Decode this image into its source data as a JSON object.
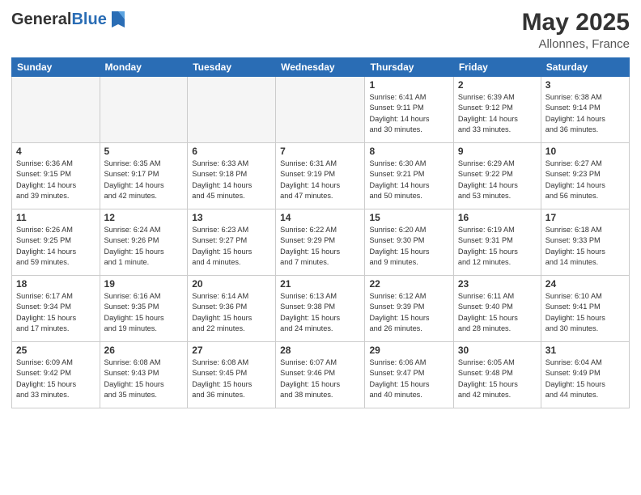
{
  "header": {
    "logo_general": "General",
    "logo_blue": "Blue",
    "month_year": "May 2025",
    "location": "Allonnes, France"
  },
  "days_of_week": [
    "Sunday",
    "Monday",
    "Tuesday",
    "Wednesday",
    "Thursday",
    "Friday",
    "Saturday"
  ],
  "weeks": [
    [
      {
        "day": "",
        "info": ""
      },
      {
        "day": "",
        "info": ""
      },
      {
        "day": "",
        "info": ""
      },
      {
        "day": "",
        "info": ""
      },
      {
        "day": "1",
        "info": "Sunrise: 6:41 AM\nSunset: 9:11 PM\nDaylight: 14 hours\nand 30 minutes."
      },
      {
        "day": "2",
        "info": "Sunrise: 6:39 AM\nSunset: 9:12 PM\nDaylight: 14 hours\nand 33 minutes."
      },
      {
        "day": "3",
        "info": "Sunrise: 6:38 AM\nSunset: 9:14 PM\nDaylight: 14 hours\nand 36 minutes."
      }
    ],
    [
      {
        "day": "4",
        "info": "Sunrise: 6:36 AM\nSunset: 9:15 PM\nDaylight: 14 hours\nand 39 minutes."
      },
      {
        "day": "5",
        "info": "Sunrise: 6:35 AM\nSunset: 9:17 PM\nDaylight: 14 hours\nand 42 minutes."
      },
      {
        "day": "6",
        "info": "Sunrise: 6:33 AM\nSunset: 9:18 PM\nDaylight: 14 hours\nand 45 minutes."
      },
      {
        "day": "7",
        "info": "Sunrise: 6:31 AM\nSunset: 9:19 PM\nDaylight: 14 hours\nand 47 minutes."
      },
      {
        "day": "8",
        "info": "Sunrise: 6:30 AM\nSunset: 9:21 PM\nDaylight: 14 hours\nand 50 minutes."
      },
      {
        "day": "9",
        "info": "Sunrise: 6:29 AM\nSunset: 9:22 PM\nDaylight: 14 hours\nand 53 minutes."
      },
      {
        "day": "10",
        "info": "Sunrise: 6:27 AM\nSunset: 9:23 PM\nDaylight: 14 hours\nand 56 minutes."
      }
    ],
    [
      {
        "day": "11",
        "info": "Sunrise: 6:26 AM\nSunset: 9:25 PM\nDaylight: 14 hours\nand 59 minutes."
      },
      {
        "day": "12",
        "info": "Sunrise: 6:24 AM\nSunset: 9:26 PM\nDaylight: 15 hours\nand 1 minute."
      },
      {
        "day": "13",
        "info": "Sunrise: 6:23 AM\nSunset: 9:27 PM\nDaylight: 15 hours\nand 4 minutes."
      },
      {
        "day": "14",
        "info": "Sunrise: 6:22 AM\nSunset: 9:29 PM\nDaylight: 15 hours\nand 7 minutes."
      },
      {
        "day": "15",
        "info": "Sunrise: 6:20 AM\nSunset: 9:30 PM\nDaylight: 15 hours\nand 9 minutes."
      },
      {
        "day": "16",
        "info": "Sunrise: 6:19 AM\nSunset: 9:31 PM\nDaylight: 15 hours\nand 12 minutes."
      },
      {
        "day": "17",
        "info": "Sunrise: 6:18 AM\nSunset: 9:33 PM\nDaylight: 15 hours\nand 14 minutes."
      }
    ],
    [
      {
        "day": "18",
        "info": "Sunrise: 6:17 AM\nSunset: 9:34 PM\nDaylight: 15 hours\nand 17 minutes."
      },
      {
        "day": "19",
        "info": "Sunrise: 6:16 AM\nSunset: 9:35 PM\nDaylight: 15 hours\nand 19 minutes."
      },
      {
        "day": "20",
        "info": "Sunrise: 6:14 AM\nSunset: 9:36 PM\nDaylight: 15 hours\nand 22 minutes."
      },
      {
        "day": "21",
        "info": "Sunrise: 6:13 AM\nSunset: 9:38 PM\nDaylight: 15 hours\nand 24 minutes."
      },
      {
        "day": "22",
        "info": "Sunrise: 6:12 AM\nSunset: 9:39 PM\nDaylight: 15 hours\nand 26 minutes."
      },
      {
        "day": "23",
        "info": "Sunrise: 6:11 AM\nSunset: 9:40 PM\nDaylight: 15 hours\nand 28 minutes."
      },
      {
        "day": "24",
        "info": "Sunrise: 6:10 AM\nSunset: 9:41 PM\nDaylight: 15 hours\nand 30 minutes."
      }
    ],
    [
      {
        "day": "25",
        "info": "Sunrise: 6:09 AM\nSunset: 9:42 PM\nDaylight: 15 hours\nand 33 minutes."
      },
      {
        "day": "26",
        "info": "Sunrise: 6:08 AM\nSunset: 9:43 PM\nDaylight: 15 hours\nand 35 minutes."
      },
      {
        "day": "27",
        "info": "Sunrise: 6:08 AM\nSunset: 9:45 PM\nDaylight: 15 hours\nand 36 minutes."
      },
      {
        "day": "28",
        "info": "Sunrise: 6:07 AM\nSunset: 9:46 PM\nDaylight: 15 hours\nand 38 minutes."
      },
      {
        "day": "29",
        "info": "Sunrise: 6:06 AM\nSunset: 9:47 PM\nDaylight: 15 hours\nand 40 minutes."
      },
      {
        "day": "30",
        "info": "Sunrise: 6:05 AM\nSunset: 9:48 PM\nDaylight: 15 hours\nand 42 minutes."
      },
      {
        "day": "31",
        "info": "Sunrise: 6:04 AM\nSunset: 9:49 PM\nDaylight: 15 hours\nand 44 minutes."
      }
    ]
  ]
}
